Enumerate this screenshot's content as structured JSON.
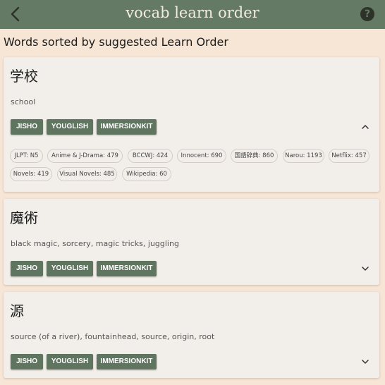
{
  "app": {
    "title": "vocab learn order",
    "help_label": "?"
  },
  "heading": "Words sorted by suggested Learn Order",
  "buttons": {
    "jisho": "JISHO",
    "youglish": "YOUGLISH",
    "immersionkit": "IMMERSIONKIT"
  },
  "cards": [
    {
      "word": "学校",
      "meaning": "school",
      "expanded": true,
      "chips": [
        "JLPT: N5",
        "Anime & J-Drama: 479",
        "BCCWJ: 424",
        "Innocent: 690",
        "国語辞典: 860",
        "Narou: 1193",
        "Netflix: 457",
        "Novels: 419",
        "Visual Novels: 485",
        "Wikipedia: 60"
      ]
    },
    {
      "word": "魔術",
      "meaning": "black magic, sorcery, magic tricks, juggling",
      "expanded": false
    },
    {
      "word": "源",
      "meaning": "source (of a river), fountainhead, source, origin, root",
      "expanded": false
    }
  ],
  "icons": {
    "back": "arrow-back-icon",
    "help": "help-icon",
    "expand": "chevron-up-icon",
    "collapse": "chevron-down-icon"
  }
}
